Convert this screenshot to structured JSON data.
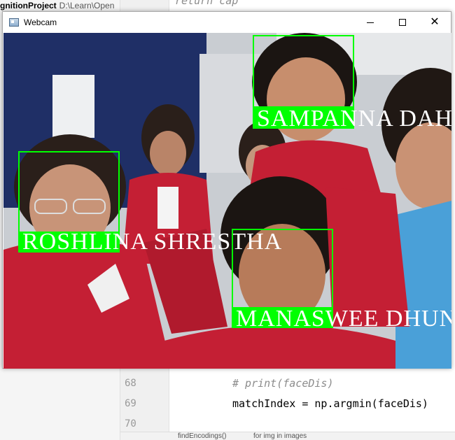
{
  "ide": {
    "project_name": "gnitionProject",
    "project_path": "D:\\Learn\\Open",
    "line_numbers": [
      "68",
      "69",
      "70"
    ],
    "code_lines": [
      {
        "text": "# print(faceDis)",
        "comment": true
      },
      {
        "text": "matchIndex = np.argmin(faceDis)",
        "comment": false
      },
      {
        "text": "",
        "comment": false
      }
    ],
    "top_code": "return cap",
    "status_items": [
      "findEncodings()",
      "for img in images"
    ]
  },
  "window": {
    "title": "Webcam",
    "controls": {
      "minimize": "—",
      "maximize": "☐",
      "close": "✕"
    }
  },
  "faces": [
    {
      "name": "SAMPANNA DAHAL"
    },
    {
      "name": "ROSHLINA SHRESTHA"
    },
    {
      "name": "MANASWEE DHUNGANA"
    }
  ],
  "colors": {
    "box": "#00ff00",
    "label_text": "#ffffff"
  }
}
